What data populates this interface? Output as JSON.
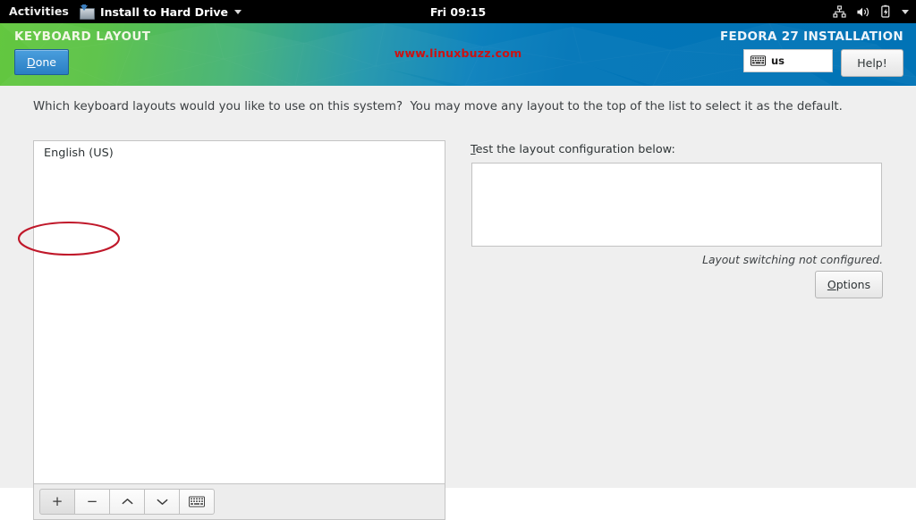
{
  "topbar": {
    "activities": "Activities",
    "app_menu": "Install to Hard Drive",
    "app_icon": "install-to-hard-drive-icon",
    "app_caret": "chevron-down-icon",
    "clock": "Fri 09:15",
    "tray": [
      {
        "name": "network-icon"
      },
      {
        "name": "volume-icon"
      },
      {
        "name": "battery-icon"
      },
      {
        "name": "system-menu-chevron-icon"
      }
    ]
  },
  "header": {
    "title": "KEYBOARD LAYOUT",
    "done_label": "Done",
    "done_mnemonic": "D",
    "watermark": "www.linuxbuzz.com",
    "install_label": "FEDORA 27 INSTALLATION",
    "keyboard_indicator": "us",
    "keyboard_icon": "keyboard-icon",
    "help_label": "Help!",
    "colors": {
      "gradient_start": "#63c73f",
      "gradient_mid": "#2397ab",
      "gradient_end": "#0173b6",
      "done_button": "#2a7fc4",
      "watermark_color": "#cc1111"
    }
  },
  "main": {
    "instruction": "Which keyboard layouts would you like to use on this system?  You may move any layout to the top of the list to select it as the default.",
    "layouts": [
      {
        "label": "English (US)"
      }
    ],
    "toolbar_buttons": [
      {
        "name": "add-layout-button",
        "symbol": "+",
        "icon": "plus-icon"
      },
      {
        "name": "remove-layout-button",
        "symbol": "−",
        "icon": "minus-icon"
      },
      {
        "name": "move-layout-up-button",
        "symbol": "⌃",
        "icon": "chevron-up-icon"
      },
      {
        "name": "move-layout-down-button",
        "symbol": "⌄",
        "icon": "chevron-down-icon"
      },
      {
        "name": "preview-layout-button",
        "symbol": "",
        "icon": "keyboard-icon"
      }
    ],
    "test_label": "Test the layout configuration below:",
    "test_label_mnemonic": "T",
    "test_value": "",
    "test_placeholder": "",
    "switch_status": "Layout switching not configured.",
    "options_label": "Options",
    "options_mnemonic": "O",
    "annotation": {
      "name": "red-highlight-ellipse",
      "color": "#c0182a",
      "targets": "English (US)"
    }
  }
}
